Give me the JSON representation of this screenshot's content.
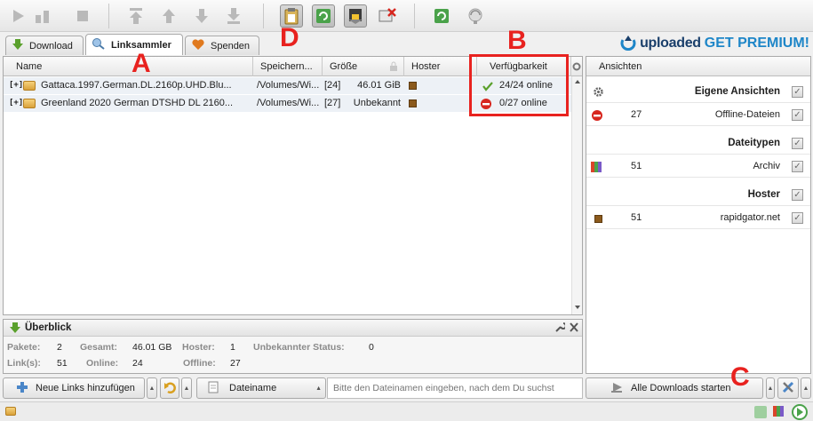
{
  "toolbar": {
    "icons": [
      "play-icon",
      "pause-icon",
      "stop-icon",
      "move-top-icon",
      "move-up-icon",
      "move-down-icon",
      "move-bottom-icon",
      "clipboard-monitor-icon",
      "auto-reconnect-icon",
      "premium-icon",
      "silent-mode-icon",
      "reconnect-icon",
      "update-icon"
    ]
  },
  "tabs": [
    {
      "label": "Download",
      "icon": "download-arrow-icon",
      "active": false
    },
    {
      "label": "Linksammler",
      "icon": "linkgrabber-icon",
      "active": true
    },
    {
      "label": "Spenden",
      "icon": "heart-icon",
      "active": false
    }
  ],
  "brand": {
    "name": "uploaded",
    "cta": "GET PREMIUM!"
  },
  "table": {
    "columns": [
      "Name",
      "Speichern...",
      "Größe",
      "Hoster",
      "Verfügbarkeit"
    ],
    "rows": [
      {
        "expander": "[+]",
        "name": "Gattaca.1997.German.DL.2160p.UHD.Blu...",
        "save": "/Volumes/Wi...",
        "count": "[24]",
        "size": "46.01 GiB",
        "availability": "24/24 online",
        "status": "online"
      },
      {
        "expander": "[+]",
        "name": "Greenland 2020 German DTSHD DL 2160...",
        "save": "/Volumes/Wi...",
        "count": "[27]",
        "size": "Unbekannt",
        "availability": "0/27 online",
        "status": "offline"
      }
    ]
  },
  "overview": {
    "title": "Überblick",
    "labels": {
      "pakete": "Pakete:",
      "gesamt": "Gesamt:",
      "hoster": "Hoster:",
      "unknown": "Unbekannter Status:",
      "links": "Link(s):",
      "online": "Online:",
      "offline": "Offline:"
    },
    "values": {
      "pakete": "2",
      "gesamt": "46.01 GB",
      "hoster": "1",
      "unknown": "0",
      "links": "51",
      "online": "24",
      "offline": "27"
    }
  },
  "bottom": {
    "add_links": "Neue Links hinzufügen",
    "search_field": "Dateiname",
    "search_placeholder": "Bitte den Dateinamen eingeben, nach dem Du suchst",
    "start_all": "Alle Downloads starten"
  },
  "sidebar": {
    "title": "Ansichten",
    "sections": [
      {
        "title": "Eigene Ansichten",
        "items": [
          {
            "count": "27",
            "label": "Offline-Dateien",
            "icon": "offline-icon"
          }
        ]
      },
      {
        "title": "Dateitypen",
        "items": [
          {
            "count": "51",
            "label": "Archiv",
            "icon": "archive-icon"
          }
        ]
      },
      {
        "title": "Hoster",
        "items": [
          {
            "count": "51",
            "label": "rapidgator.net",
            "icon": "rapidgator-icon"
          }
        ]
      }
    ]
  },
  "annotations": {
    "a": "A",
    "b": "B",
    "c": "C",
    "d": "D",
    "color": "#e8221f"
  },
  "colors": {
    "online": "#5aa02c",
    "offline": "#d7261e",
    "row_bg": "#edf1f6",
    "brand_dark": "#1a3f6b",
    "brand_blue": "#1e86c8"
  }
}
